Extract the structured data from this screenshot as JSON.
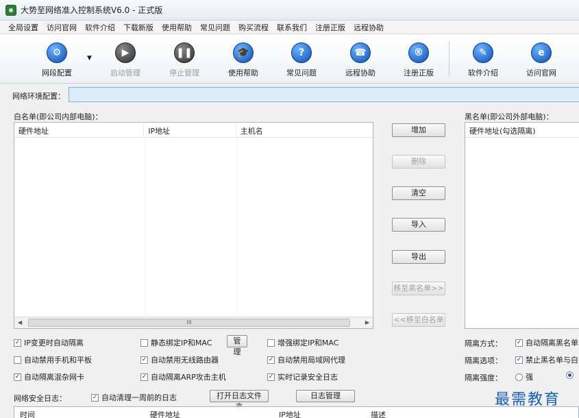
{
  "window": {
    "title": "大势至网络准入控制系统V6.0 - 正式版"
  },
  "menu": [
    "全局设置",
    "访问官网",
    "软件介绍",
    "下载新版",
    "使用帮助",
    "常见问题",
    "购买流程",
    "联系我们",
    "注册正版",
    "远程协助"
  ],
  "toolbar": {
    "buttons": [
      {
        "label": "网段配置",
        "glyph": "⚙",
        "icon": "gear-icon"
      },
      {
        "label": "启动管理",
        "glyph": "▶",
        "icon": "play-icon"
      },
      {
        "label": "停止管理",
        "glyph": "❚❚",
        "icon": "pause-icon"
      },
      {
        "label": "使用帮助",
        "glyph": "🎓",
        "icon": "graduation-cap-icon"
      },
      {
        "label": "常见问题",
        "glyph": "?",
        "icon": "question-icon"
      },
      {
        "label": "远程协助",
        "glyph": "☎",
        "icon": "remote-assist-icon"
      },
      {
        "label": "注册正版",
        "glyph": "®",
        "icon": "registered-icon"
      },
      {
        "label": "软件介绍",
        "glyph": "✎",
        "icon": "pen-icon"
      },
      {
        "label": "访问官网",
        "glyph": "e",
        "icon": "browser-icon"
      }
    ],
    "dropdown_glyph": "▼"
  },
  "env": {
    "label": "网络环境配置："
  },
  "whitelist": {
    "label": "白名单(即公司内部电脑)：",
    "columns": [
      "硬件地址",
      "IP地址",
      "主机名"
    ],
    "scroll_glyph": "III"
  },
  "blacklist": {
    "label": "黑名单(即公司外部电脑)：",
    "columns": [
      "硬件地址(勾选隔离)"
    ]
  },
  "side_buttons": {
    "add": "增加",
    "delete": "删除",
    "clear": "清空",
    "import": "导入",
    "export": "导出",
    "to_black": "移至黑名单>>",
    "to_white": "<<移至白名单"
  },
  "options": {
    "ip_change_isolate": "IP变更时自动隔离",
    "static_bind": "静态绑定IP和MAC",
    "manage_btn": "管理",
    "enhanced_bind": "增强绑定IP和MAC",
    "disable_mobile": "自动禁用手机和平板",
    "disable_wireless_router": "自动禁用无线路由器",
    "disable_lan_proxy": "自动禁用局域网代理",
    "isolate_promiscuous": "自动隔离混杂网卡",
    "isolate_arp": "自动隔离ARP攻击主机",
    "realtime_log": "实时记录安全日志"
  },
  "isolation": {
    "mode_label": "隔离方式：",
    "mode_option": "自动隔离黑名单",
    "options_label": "隔离选项：",
    "options_option": "禁止黑名单与白",
    "strength_label": "隔离强度：",
    "strong": "强"
  },
  "log": {
    "label": "网络安全日志：",
    "auto_clean": "自动清理一周前的日志",
    "open_folder_btn": "打开日志文件夹",
    "manage_btn": "日志管理",
    "columns": [
      "时间",
      "硬件地址",
      "IP地址",
      "描述"
    ]
  },
  "watermark": "最需教育",
  "check_glyph": "✓",
  "colors": {
    "accent": "#0a4fb0",
    "env_input_bg": "#dcecfa"
  }
}
